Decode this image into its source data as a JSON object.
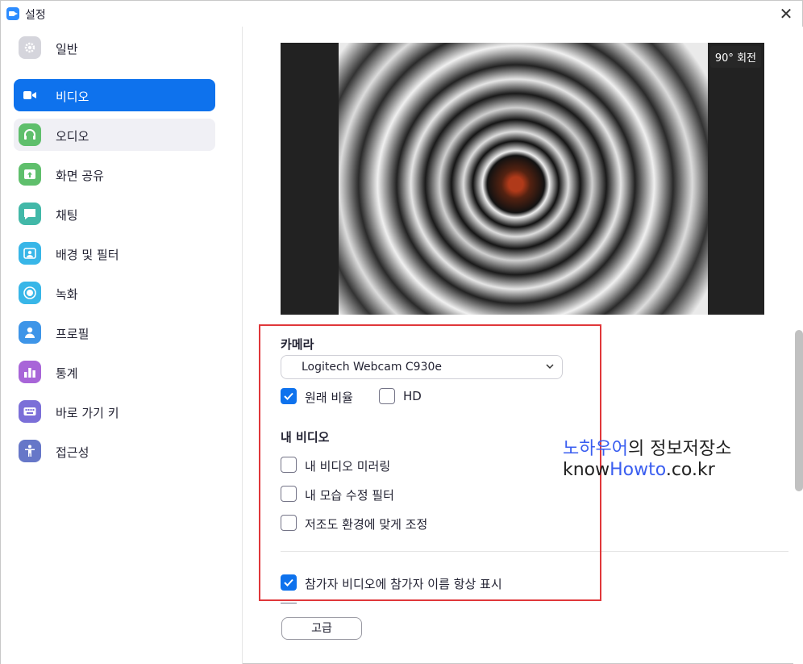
{
  "window": {
    "title": "설정"
  },
  "sidebar": {
    "items": [
      {
        "label": "일반",
        "icon": "gear-icon",
        "color": "#cfcfd6"
      },
      {
        "label": "비디오",
        "icon": "video-camera-icon",
        "color": "#0e72ed",
        "active": true
      },
      {
        "label": "오디오",
        "icon": "headphones-icon",
        "color": "#5fbf6c"
      },
      {
        "label": "화면 공유",
        "icon": "share-screen-icon",
        "color": "#5fbf6c"
      },
      {
        "label": "채팅",
        "icon": "chat-bubble-icon",
        "color": "#42b8a8"
      },
      {
        "label": "배경 및 필터",
        "icon": "background-portrait-icon",
        "color": "#38b6e8"
      },
      {
        "label": "녹화",
        "icon": "record-icon",
        "color": "#38b6e8"
      },
      {
        "label": "프로필",
        "icon": "person-icon",
        "color": "#3e95e8"
      },
      {
        "label": "통계",
        "icon": "bar-chart-icon",
        "color": "#a865d8"
      },
      {
        "label": "바로 가기 키",
        "icon": "keyboard-icon",
        "color": "#7b6fd8"
      },
      {
        "label": "접근성",
        "icon": "accessibility-icon",
        "color": "#6677c8"
      }
    ]
  },
  "video": {
    "rotate_label": "90° 회전",
    "camera_title": "카메라",
    "camera_select": "Logitech Webcam C930e",
    "original_ratio": {
      "label": "원래 비율",
      "checked": true
    },
    "hd": {
      "label": "HD",
      "checked": false
    },
    "my_video_title": "내 비디오",
    "mirror": {
      "label": "내 비디오 미러링",
      "checked": false
    },
    "touch_up": {
      "label": "내 모습 수정 필터",
      "checked": false
    },
    "low_light": {
      "label": "저조도 환경에 맞게 조정",
      "checked": false
    },
    "show_names": {
      "label": "참가자 비디오에 참가자 이름 항상 표시",
      "checked": true
    },
    "advanced_button": "고급"
  },
  "watermark": {
    "line1_blue": "노하우어",
    "line1_rest": "의 정보저장소",
    "line2_a": "know",
    "line2_blue": "Howto",
    "line2_b": ".co.kr"
  },
  "colors": {
    "accent": "#0e72ed",
    "highlight": "#e0373a"
  }
}
